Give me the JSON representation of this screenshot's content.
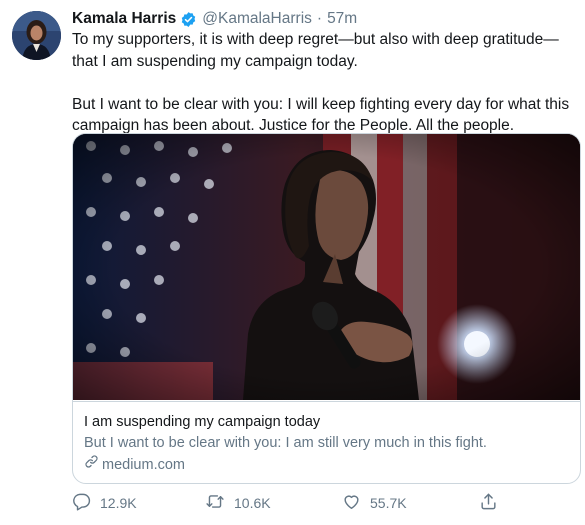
{
  "tweet": {
    "author_name": "Kamala Harris",
    "handle": "@KamalaHarris",
    "separator": "·",
    "time": "57m",
    "text_line1": "To my supporters, it is with deep regret—but also with deep gratitude—that I am suspending my campaign today.",
    "text_line2": "But I want to be clear with you: I will keep fighting every day for what this campaign has been about. Justice for the People. All the people."
  },
  "card": {
    "title": "I am suspending my campaign today",
    "description": "But I want to be clear with you: I am still very much in this fight.",
    "domain": "medium.com"
  },
  "actions": {
    "reply_count": "12.9K",
    "retweet_count": "10.6K",
    "like_count": "55.7K"
  },
  "colors": {
    "text": "#14171a",
    "secondary": "#657786",
    "verified": "#1da1f2",
    "border": "#ccd6dd"
  },
  "icons": {
    "verified": "verified-badge-icon",
    "reply": "reply-icon",
    "retweet": "retweet-icon",
    "like": "heart-icon",
    "share": "share-icon",
    "link": "link-icon"
  }
}
